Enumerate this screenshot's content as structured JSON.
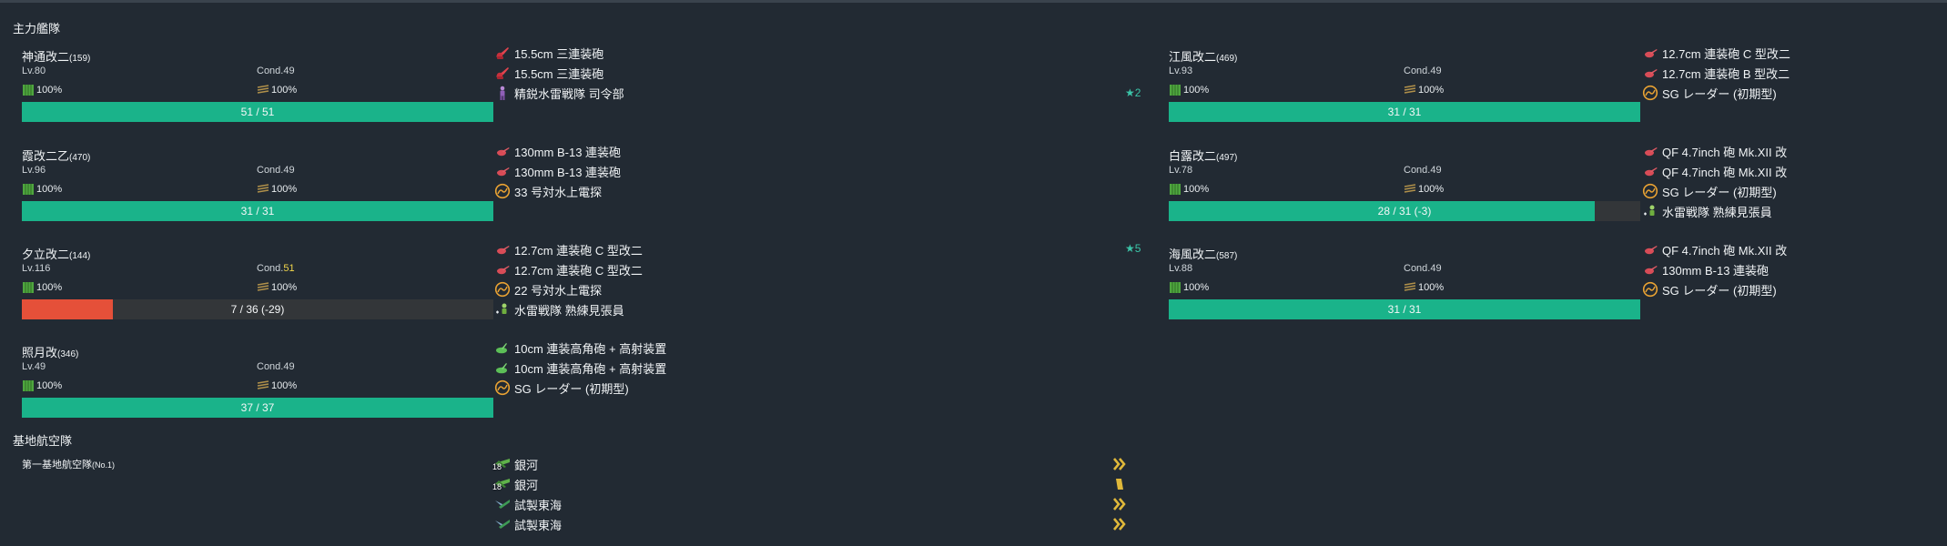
{
  "sections": {
    "main_fleet": "主力艦隊",
    "air_base": "基地航空隊"
  },
  "ships": [
    {
      "name": "神通改二",
      "id": "(159)",
      "lv": "Lv.80",
      "cond_label": "Cond.",
      "cond_value": "49",
      "cond_warn": false,
      "fuel": "100%",
      "ammo": "100%",
      "hp": "51 / 51",
      "hp_fraction": 1.0,
      "equips": [
        {
          "icon": "main-gun-icon",
          "name": "15.5cm 三連装砲"
        },
        {
          "icon": "main-gun-icon",
          "name": "15.5cm 三連装砲"
        },
        {
          "icon": "personnel-icon",
          "name": "精鋭水雷戦隊 司令部"
        }
      ],
      "star": "★2"
    },
    {
      "name": "霞改二乙",
      "id": "(470)",
      "lv": "Lv.96",
      "cond_label": "Cond.",
      "cond_value": "49",
      "cond_warn": false,
      "fuel": "100%",
      "ammo": "100%",
      "hp": "31 / 31",
      "hp_fraction": 1.0,
      "equips": [
        {
          "icon": "small-gun-icon",
          "name": "130mm B-13 連装砲"
        },
        {
          "icon": "small-gun-icon",
          "name": "130mm B-13 連装砲"
        },
        {
          "icon": "radar-icon",
          "name": "33 号対水上電探"
        }
      ],
      "star": ""
    },
    {
      "name": "夕立改二",
      "id": "(144)",
      "lv": "Lv.116",
      "cond_label": "Cond.",
      "cond_value": "51",
      "cond_warn": true,
      "fuel": "100%",
      "ammo": "100%",
      "hp": "7 / 36 (-29)",
      "hp_fraction": 0.194,
      "equips": [
        {
          "icon": "small-gun-icon",
          "name": "12.7cm 連装砲 C 型改二"
        },
        {
          "icon": "small-gun-icon",
          "name": "12.7cm 連装砲 C 型改二"
        },
        {
          "icon": "radar-icon",
          "name": "22 号対水上電探"
        },
        {
          "icon": "lookout-icon",
          "name": "水雷戦隊 熟練見張員"
        }
      ],
      "star": "★5"
    },
    {
      "name": "照月改",
      "id": "(346)",
      "lv": "Lv.49",
      "cond_label": "Cond.",
      "cond_value": "49",
      "cond_warn": false,
      "fuel": "100%",
      "ammo": "100%",
      "hp": "37 / 37",
      "hp_fraction": 1.0,
      "equips": [
        {
          "icon": "aa-gun-icon",
          "name": "10cm 連装高角砲 + 高射装置"
        },
        {
          "icon": "aa-gun-icon",
          "name": "10cm 連装高角砲 + 高射装置"
        },
        {
          "icon": "radar-icon",
          "name": "SG レーダー (初期型)"
        }
      ],
      "star": ""
    },
    {
      "name": "江風改二",
      "id": "(469)",
      "lv": "Lv.93",
      "cond_label": "Cond.",
      "cond_value": "49",
      "cond_warn": false,
      "fuel": "100%",
      "ammo": "100%",
      "hp": "31 / 31",
      "hp_fraction": 1.0,
      "equips": [
        {
          "icon": "small-gun-icon",
          "name": "12.7cm 連装砲 C 型改二"
        },
        {
          "icon": "small-gun-icon",
          "name": "12.7cm 連装砲 B 型改二"
        },
        {
          "icon": "radar-icon",
          "name": "SG レーダー (初期型)"
        }
      ],
      "star": ""
    },
    {
      "name": "白露改二",
      "id": "(497)",
      "lv": "Lv.78",
      "cond_label": "Cond.",
      "cond_value": "49",
      "cond_warn": false,
      "fuel": "100%",
      "ammo": "100%",
      "hp": "28 / 31 (-3)",
      "hp_fraction": 0.903,
      "equips": [
        {
          "icon": "small-gun-icon",
          "name": "QF 4.7inch 砲 Mk.XII 改"
        },
        {
          "icon": "small-gun-icon",
          "name": "QF 4.7inch 砲 Mk.XII 改"
        },
        {
          "icon": "radar-icon",
          "name": "SG レーダー (初期型)"
        },
        {
          "icon": "lookout-icon",
          "name": "水雷戦隊 熟練見張員"
        }
      ],
      "star": ""
    },
    {
      "name": "海風改二",
      "id": "(587)",
      "lv": "Lv.88",
      "cond_label": "Cond.",
      "cond_value": "49",
      "cond_warn": false,
      "fuel": "100%",
      "ammo": "100%",
      "hp": "31 / 31",
      "hp_fraction": 1.0,
      "equips": [
        {
          "icon": "small-gun-icon",
          "name": "QF 4.7inch 砲 Mk.XII 改"
        },
        {
          "icon": "small-gun-icon",
          "name": "130mm B-13 連装砲"
        },
        {
          "icon": "radar-icon",
          "name": "SG レーダー (初期型)"
        }
      ],
      "star": ""
    }
  ],
  "air_base": {
    "name": "第一基地航空隊",
    "id": "(No.1)",
    "planes": [
      {
        "icon": "land-bomber-icon",
        "count": "18",
        "name": "銀河",
        "prof": "chevron"
      },
      {
        "icon": "land-bomber-icon",
        "count": "18",
        "name": "銀河",
        "prof": "bar"
      },
      {
        "icon": "torpedo-bomber-icon",
        "count": "",
        "name": "試製東海",
        "prof": "chevron"
      },
      {
        "icon": "torpedo-bomber-icon",
        "count": "",
        "name": "試製東海",
        "prof": "chevron"
      }
    ]
  }
}
